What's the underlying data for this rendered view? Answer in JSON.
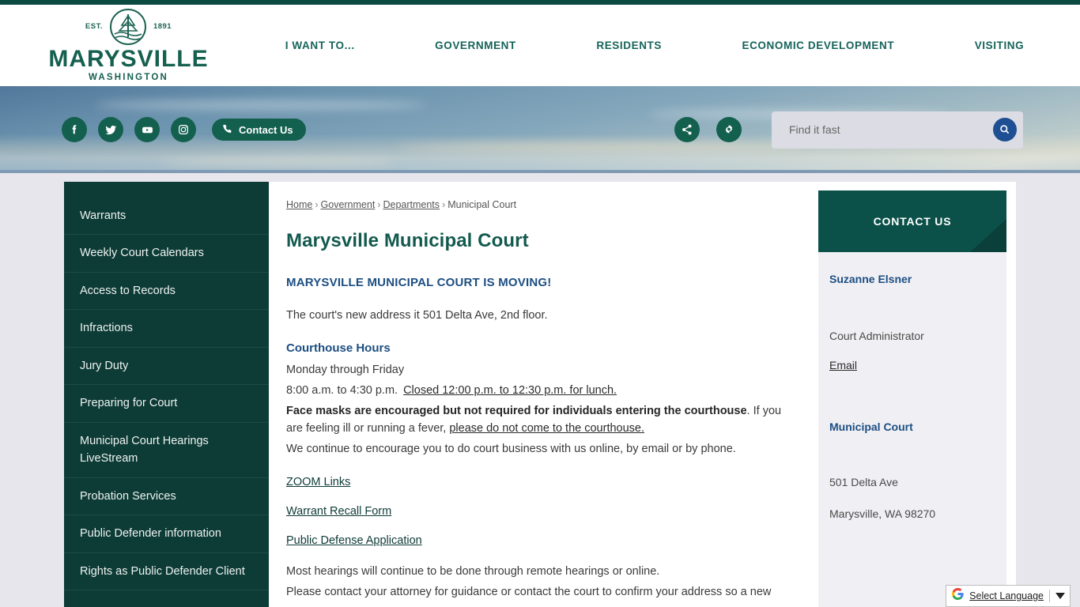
{
  "brand": {
    "est_label": "EST.",
    "year": "1891",
    "name": "MARYSVILLE",
    "state": "WASHINGTON",
    "primary_green": "#14604f",
    "dark_teal": "#0d3b36",
    "heading_blue": "#1c4e82",
    "search_blue": "#1f4f93"
  },
  "nav": {
    "items": [
      {
        "label": "I WANT TO..."
      },
      {
        "label": "GOVERNMENT"
      },
      {
        "label": "RESIDENTS"
      },
      {
        "label": "ECONOMIC DEVELOPMENT"
      },
      {
        "label": "VISITING"
      }
    ]
  },
  "utility": {
    "social": [
      {
        "name": "facebook-icon",
        "label": "Facebook"
      },
      {
        "name": "twitter-icon",
        "label": "Twitter"
      },
      {
        "name": "youtube-icon",
        "label": "YouTube"
      },
      {
        "name": "instagram-icon",
        "label": "Instagram"
      }
    ],
    "contact_us_label": "Contact Us",
    "share_icon": "share-icon",
    "settings_icon": "gear-icon"
  },
  "search": {
    "placeholder": "Find it fast",
    "value": "",
    "button_icon": "search-icon"
  },
  "sidebar": {
    "items": [
      {
        "label": "Warrants"
      },
      {
        "label": "Weekly Court Calendars"
      },
      {
        "label": "Access to Records"
      },
      {
        "label": "Infractions"
      },
      {
        "label": "Jury Duty"
      },
      {
        "label": "Preparing for Court"
      },
      {
        "label": "Municipal Court Hearings LiveStream"
      },
      {
        "label": "Probation Services"
      },
      {
        "label": "Public Defender information"
      },
      {
        "label": "Rights as Public Defender Client"
      }
    ]
  },
  "breadcrumb": {
    "items": [
      {
        "label": "Home",
        "link": true
      },
      {
        "label": "Government",
        "link": true
      },
      {
        "label": "Departments",
        "link": true
      },
      {
        "label": "Municipal Court",
        "link": false
      }
    ],
    "separator": "›"
  },
  "main": {
    "title": "Marysville Municipal Court",
    "moving_heading": "MARYSVILLE MUNICIPAL COURT IS MOVING!",
    "moving_text": "The court's new address it 501 Delta Ave, 2nd floor.",
    "hours_heading": "Courthouse Hours",
    "hours_days": "Monday through Friday",
    "hours_time": "8:00 a.m. to 4:30 p.m.",
    "hours_lunch": "Closed 12:00 p.m. to 12:30 p.m. for lunch.",
    "mask_bold": "Face masks are encouraged but not required for individuals entering the courthouse",
    "mask_rest": ". If you are feeling ill or running a fever, ",
    "mask_link": "please do not come to the courthouse.",
    "encourage_text": "We continue to encourage you to do court business with us online, by email or by phone.",
    "link_zoom": "ZOOM Links",
    "link_warrant": "Warrant Recall Form",
    "link_public_defense": "Public Defense Application",
    "remote_line1": "Most hearings will continue to be done through remote hearings or online.",
    "remote_line2": "Please contact your attorney for guidance or contact the court to confirm your address so a new"
  },
  "contact": {
    "header": "CONTACT US",
    "person_name": "Suzanne Elsner",
    "person_role": "Court Administrator",
    "email_label": "Email",
    "department": "Municipal Court",
    "address_line1": "501 Delta Ave",
    "address_line2": "Marysville, WA 98270"
  },
  "translate": {
    "label": "Select Language",
    "icon": "google-g-icon",
    "caret": "chevron-down-icon"
  }
}
